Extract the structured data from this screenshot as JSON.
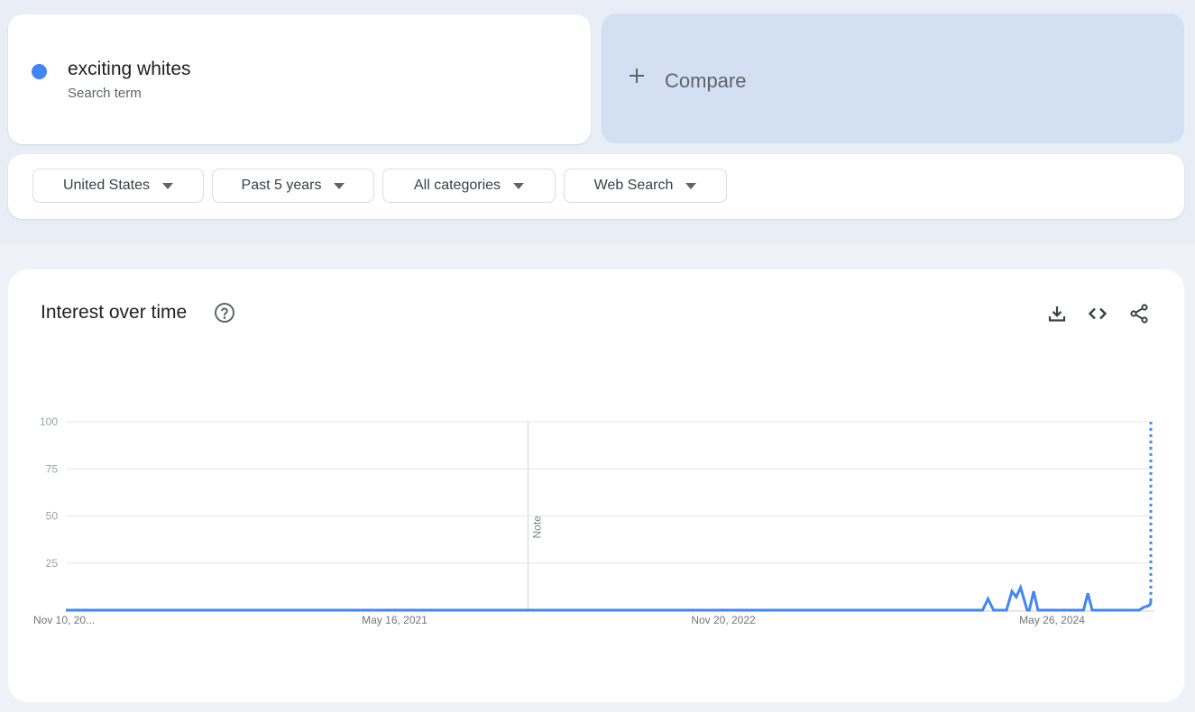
{
  "search_term": {
    "name": "exciting whites",
    "subtitle": "Search term",
    "color": "#4285f4"
  },
  "compare": {
    "label": "Compare",
    "icon": "plus-icon",
    "background": "#d3e0f4"
  },
  "filters": [
    {
      "label": "United States",
      "icon": "caret-down-icon"
    },
    {
      "label": "Past 5 years",
      "icon": "caret-down-icon"
    },
    {
      "label": "All categories",
      "icon": "caret-down-icon"
    },
    {
      "label": "Web Search",
      "icon": "caret-down-icon"
    }
  ],
  "panel": {
    "title": "Interest over time",
    "help_icon": "help-circle-icon",
    "actions": [
      {
        "name": "download",
        "icon": "download-icon"
      },
      {
        "name": "embed",
        "icon": "code-icon"
      },
      {
        "name": "share",
        "icon": "share-icon"
      }
    ]
  },
  "chart_data": {
    "type": "line",
    "title": "Interest over time",
    "xlabel": "",
    "ylabel": "",
    "ylim": [
      0,
      100
    ],
    "y_ticks": [
      25,
      50,
      75,
      100
    ],
    "x_tick_labels": [
      "Nov 10, 20...",
      "May 16, 2021",
      "Nov 20, 2022",
      "May 26, 2024"
    ],
    "x_tick_positions": [
      0,
      0.303,
      0.606,
      0.909
    ],
    "grid": true,
    "annotations": [
      {
        "text": "Note",
        "at": 0.426
      }
    ],
    "series": [
      {
        "name": "exciting whites",
        "color": "#4285f4",
        "points": [
          {
            "x": 0.0,
            "y": 0
          },
          {
            "x": 0.845,
            "y": 0
          },
          {
            "x": 0.85,
            "y": 6
          },
          {
            "x": 0.855,
            "y": 0
          },
          {
            "x": 0.867,
            "y": 0
          },
          {
            "x": 0.872,
            "y": 10
          },
          {
            "x": 0.876,
            "y": 7
          },
          {
            "x": 0.88,
            "y": 12
          },
          {
            "x": 0.886,
            "y": 0
          },
          {
            "x": 0.888,
            "y": 0
          },
          {
            "x": 0.892,
            "y": 10
          },
          {
            "x": 0.896,
            "y": 0
          },
          {
            "x": 0.938,
            "y": 0
          },
          {
            "x": 0.942,
            "y": 9
          },
          {
            "x": 0.946,
            "y": 0
          },
          {
            "x": 0.989,
            "y": 0
          },
          {
            "x": 0.995,
            "y": 2
          }
        ],
        "partial_points": [
          {
            "x": 0.995,
            "y": 2
          },
          {
            "x": 1.0,
            "y": 100
          }
        ]
      }
    ]
  }
}
